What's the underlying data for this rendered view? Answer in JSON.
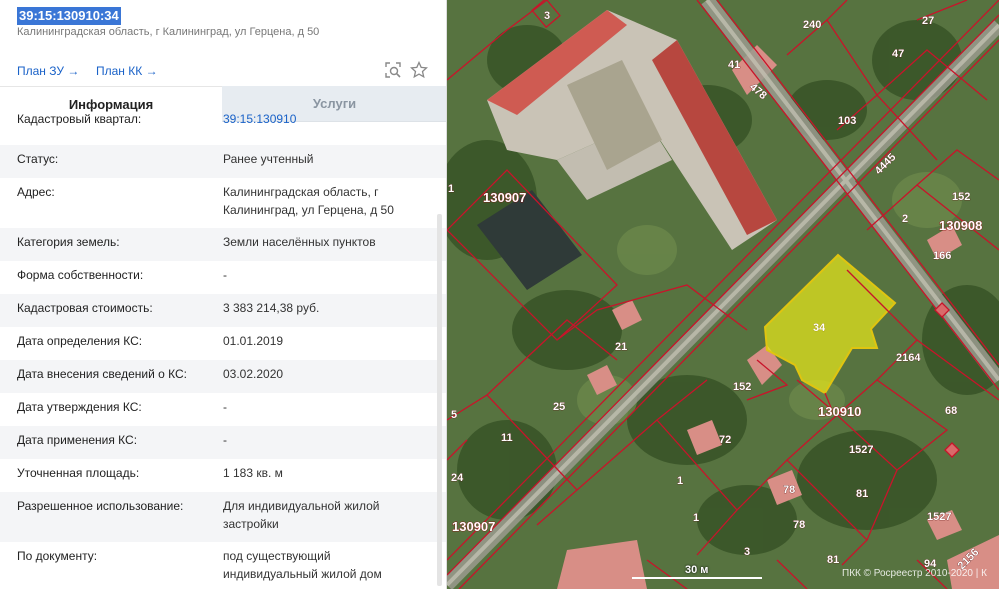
{
  "header": {
    "cad_number": "39:15:130910:34",
    "address": "Калининградская область, г Калининград, ул Герцена, д 50",
    "plan_zu": "План ЗУ →",
    "plan_kk": "План КК →",
    "icons": [
      "zoom-search-icon",
      "star-icon"
    ]
  },
  "tabs": {
    "info": "Информация",
    "services": "Услуги"
  },
  "rows": [
    {
      "label": "Кадастровый квартал:",
      "value": "39:15:130910",
      "link": true
    },
    {
      "label": "Статус:",
      "value": "Ранее учтенный"
    },
    {
      "label": "Адрес:",
      "value": "Калининградская область, г Калининград, ул Герцена, д 50"
    },
    {
      "label": "Категория земель:",
      "value": "Земли населённых пунктов"
    },
    {
      "label": "Форма собственности:",
      "value": "-"
    },
    {
      "label": "Кадастровая стоимость:",
      "value": "3 383 214,38 руб."
    },
    {
      "label": "Дата определения КС:",
      "value": "01.01.2019"
    },
    {
      "label": "Дата внесения сведений о КС:",
      "value": "03.02.2020"
    },
    {
      "label": "Дата утверждения КС:",
      "value": "-"
    },
    {
      "label": "Дата применения КС:",
      "value": "-"
    },
    {
      "label": "Уточненная площадь:",
      "value": "1 183 кв. м"
    },
    {
      "label": "Разрешенное использование:",
      "value": "Для индивидуальной жилой застройки"
    },
    {
      "label": "По документу:",
      "value": "под существующий индивидуальный жилой дом"
    }
  ],
  "map": {
    "quarters": [
      "130907",
      "130908",
      "130910",
      "130907"
    ],
    "parcels": [
      "3",
      "240",
      "27",
      "41",
      "47",
      "478",
      "103",
      "4445",
      "152",
      "2",
      "166",
      "1",
      "34",
      "21",
      "152",
      "2164",
      "5",
      "25",
      "11",
      "72",
      "68",
      "1527",
      "24",
      "1",
      "78",
      "81",
      "1527",
      "1",
      "78",
      "3",
      "81",
      "94",
      "2156"
    ],
    "selected_parcel": "34",
    "scale": "30 м",
    "copyright": "ПКК © Росреестр 2010-2020 | К"
  },
  "colors": {
    "accent": "#1a62c8",
    "selection": "#3a76d6",
    "parcel_border": "#c8142a",
    "selected_fill": "#e6e61a"
  }
}
